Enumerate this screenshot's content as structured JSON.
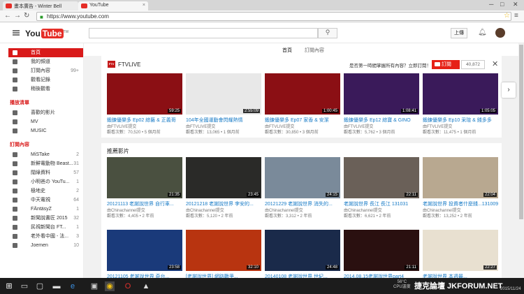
{
  "browser": {
    "tabs": [
      {
        "label": "畫本廣告 - Winter Bell"
      },
      {
        "label": "YouTube"
      }
    ],
    "url": "https://www.youtube.com"
  },
  "header": {
    "logo_text": "You",
    "logo_tube": "Tube",
    "logo_region": "TW",
    "upload_label": "上傳"
  },
  "sidebar": {
    "main_items": [
      {
        "label": "首頁",
        "count": ""
      },
      {
        "label": "我的頻道",
        "count": ""
      },
      {
        "label": "訂閱內容",
        "count": "99+"
      },
      {
        "label": "觀看記錄",
        "count": ""
      },
      {
        "label": "稍後觀看",
        "count": ""
      }
    ],
    "best_heading": "播放清單",
    "best_items": [
      {
        "label": "喜歡的影片"
      },
      {
        "label": "MV"
      },
      {
        "label": "MUSIC"
      }
    ],
    "subs_heading": "訂閱內容",
    "subs_items": [
      {
        "label": "MiSTake",
        "count": "2"
      },
      {
        "label": "新鮮電動物 Beast...",
        "count": "31"
      },
      {
        "label": "闊綠資料",
        "count": "57"
      },
      {
        "label": "小明爸の YouTu...",
        "count": "1"
      },
      {
        "label": "極地史",
        "count": "2"
      },
      {
        "label": "中天電視",
        "count": "64"
      },
      {
        "label": "FÄntäsyZ",
        "count": "1"
      },
      {
        "label": "新聞說書匠 2015",
        "count": "32"
      },
      {
        "label": "民視新聞台 FT...",
        "count": "1"
      },
      {
        "label": "老外看中國 - 法...",
        "count": "3"
      },
      {
        "label": "Joemen",
        "count": "10"
      }
    ]
  },
  "content_tabs": [
    {
      "label": "首頁"
    },
    {
      "label": "訂閱內容"
    }
  ],
  "shelf": {
    "channel": "FTVLIVE",
    "promo": "是否第一時間掌握所有內容？立即訂閱！",
    "subscribe_label": "訂閱",
    "subscriber_count": "40,872",
    "videos": [
      {
        "title": "鍛鍊優樂多 Ep02 綜藝 & 正義哥",
        "channel": "由FTVLIVE提交",
        "meta": "觀看次數：70,520 • 5 個月前",
        "duration": "59:25"
      },
      {
        "title": "104年全國運動會閃耀熱情",
        "channel": "由FTVLIVE提交",
        "meta": "觀看次數：13,065 • 1 個月前",
        "duration": "2:55:09"
      },
      {
        "title": "鍛鍊優樂多 Ep07 家香 & 安潔",
        "channel": "由FTVLIVE提交",
        "meta": "觀看次數：30,850 • 3 個月前",
        "duration": "1:00:45"
      },
      {
        "title": "鍛鍊優樂多 Ep12 綜寶 & GINO",
        "channel": "由FTVLIVE提交",
        "meta": "觀看次數：5,762 • 3 個月前",
        "duration": "1:08:41"
      },
      {
        "title": "鍛鍊優樂多 Ep10 采瑄 & 錢多多",
        "channel": "由FTVLIVE提交",
        "meta": "觀看次數：11,475 • 1 個月前",
        "duration": "1:05:05"
      }
    ]
  },
  "recommended": {
    "heading": "推薦影片",
    "row1": [
      {
        "title": "20121113 老謝說世界 自行車...",
        "channel": "由Chinachannel提交",
        "meta": "觀看次數：4,405 • 2 年前",
        "duration": "21:35"
      },
      {
        "title": "20121218 老謝說世界 李安的...",
        "channel": "由Chinachannel提交",
        "meta": "觀看次數：5,120 • 2 年前",
        "duration": "23:45"
      },
      {
        "title": "20121229 老謝說世界 消失的...",
        "channel": "由Chinachannel提交",
        "meta": "觀看次數：3,312 • 2 年前",
        "duration": "24:15"
      },
      {
        "title": "老謝說世界 長江 長江 131031",
        "channel": "由Chinachannel提交",
        "meta": "觀看次數：6,621 • 2 年前",
        "duration": "22:11"
      },
      {
        "title": "老謝說世界 投資者什麼錢...131009",
        "channel": "由Chinachannel提交",
        "meta": "觀看次數：13,252 • 2 年前",
        "duration": "22:04"
      }
    ],
    "row2": [
      {
        "title": "20121105 老謝說世界 奇台...",
        "duration": "23:58"
      },
      {
        "title": "[老謝說世界] 網路戰爭...",
        "duration": "32:10"
      },
      {
        "title": "20140108 老謝說世界 世紀...",
        "duration": "24:48"
      },
      {
        "title": "2014.08.15老謝說世界part4",
        "duration": "21:11"
      },
      {
        "title": "老謝說世界 本週最...",
        "duration": "22:27"
      }
    ]
  },
  "taskbar": {
    "temp": "56°C",
    "cpu": "CPU溫度",
    "watermark": "捷克論壇 JKFORUM.NET",
    "date": "2015/11/24"
  },
  "colors": {
    "accent": "#e52d27",
    "link": "#167ac6"
  }
}
